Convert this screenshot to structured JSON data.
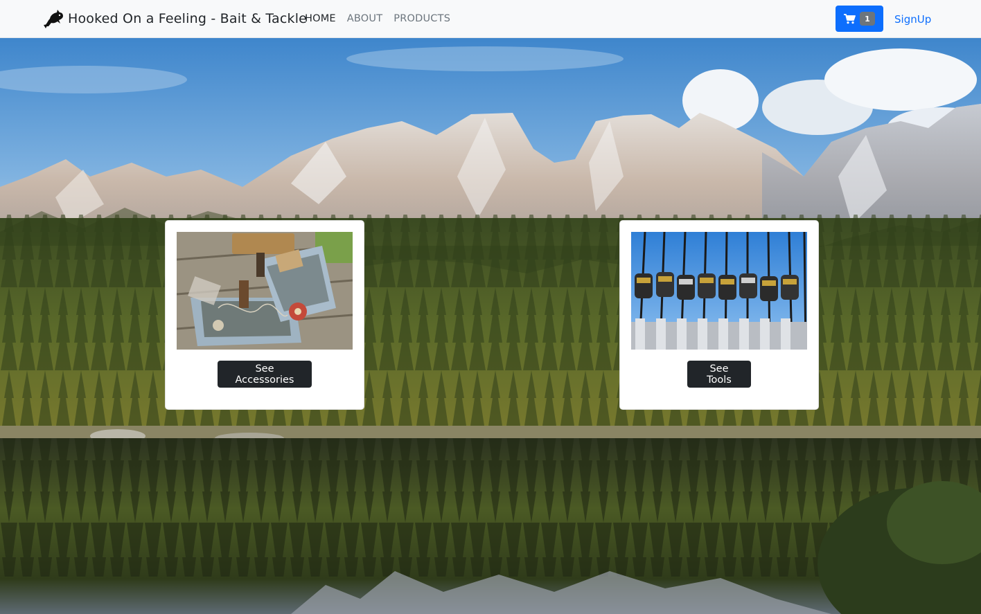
{
  "navbar": {
    "brand_icon": "fish-logo-icon",
    "brand": "Hooked On a Feeling - Bait & Tackle",
    "links": [
      {
        "label": "HOME",
        "active": true
      },
      {
        "label": "ABOUT",
        "active": false
      },
      {
        "label": "PRODUCTS",
        "active": false
      }
    ],
    "cart": {
      "icon": "cart-icon",
      "count": "1",
      "color": "#0d6efd"
    },
    "signup": "SignUp"
  },
  "hero": {
    "description_icon": "mountain-lake-forest-landscape"
  },
  "cards": [
    {
      "image_icon": "tackle-box-photo",
      "button": "See Accessories"
    },
    {
      "image_icon": "fishing-rods-photo",
      "button": "See Tools"
    }
  ],
  "colors": {
    "primary": "#0d6efd",
    "dark_button": "#212529",
    "navbar_bg": "#f8f9fa",
    "badge": "#6c757d"
  }
}
